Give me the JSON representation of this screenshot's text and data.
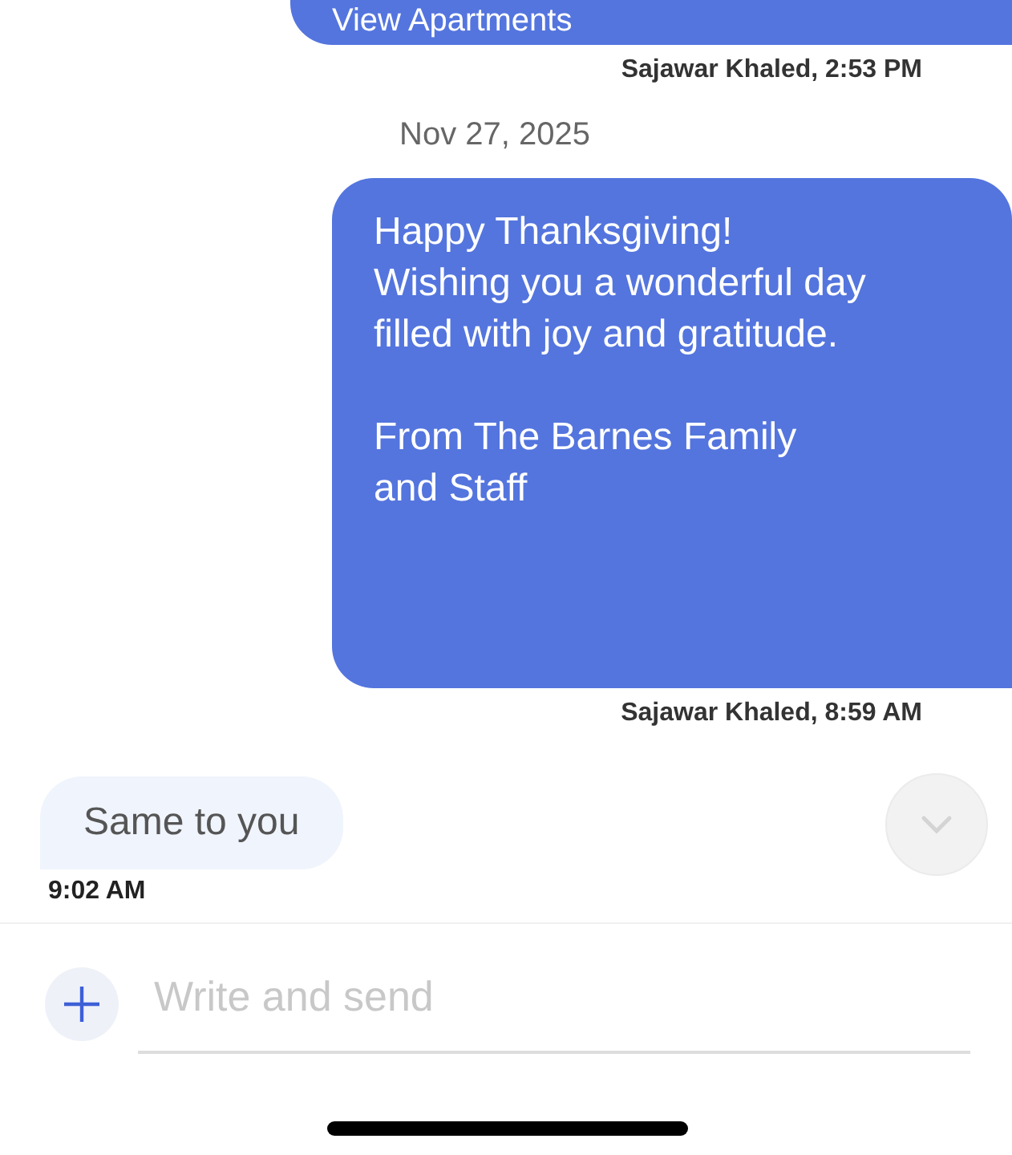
{
  "messages": [
    {
      "kind": "outgoing",
      "text": "View Apartments",
      "meta": "Sajawar Khaled, 2:53 PM",
      "cut": true
    },
    {
      "kind": "date",
      "text": "Nov 27, 2025"
    },
    {
      "kind": "outgoing",
      "text": "Happy Thanksgiving!\nWishing you a wonderful day\nfilled with joy and gratitude.\n\nFrom The Barnes Family\nand Staff",
      "meta": "Sajawar Khaled, 8:59 AM",
      "cut": false
    },
    {
      "kind": "incoming",
      "text": "Same to you",
      "meta": "9:02 AM"
    }
  ],
  "composer": {
    "placeholder": "Write and send"
  }
}
